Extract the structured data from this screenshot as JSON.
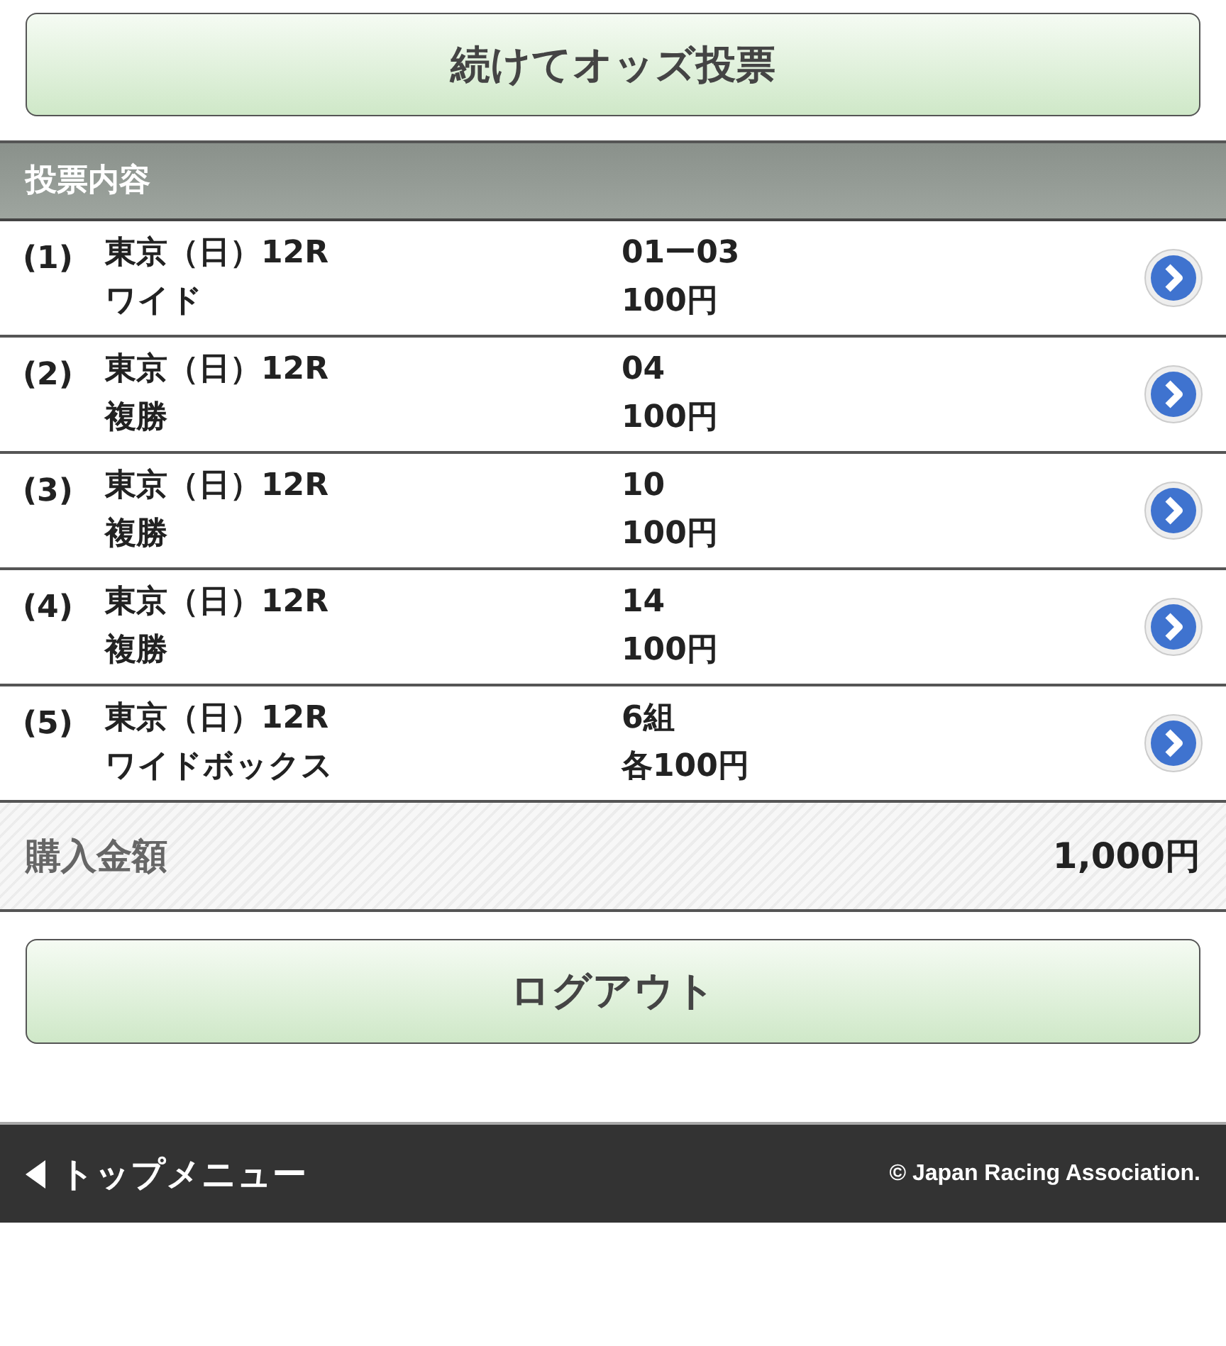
{
  "top_button": {
    "label": "続けてオッズ投票"
  },
  "section_header": {
    "title": "投票内容"
  },
  "bets": [
    {
      "index": "(1)",
      "race": "東京（日）12R",
      "bet_type": "ワイド",
      "selection": "01ー03",
      "amount": "100円"
    },
    {
      "index": "(2)",
      "race": "東京（日）12R",
      "bet_type": "複勝",
      "selection": "04",
      "amount": "100円"
    },
    {
      "index": "(3)",
      "race": "東京（日）12R",
      "bet_type": "複勝",
      "selection": "10",
      "amount": "100円"
    },
    {
      "index": "(4)",
      "race": "東京（日）12R",
      "bet_type": "複勝",
      "selection": "14",
      "amount": "100円"
    },
    {
      "index": "(5)",
      "race": "東京（日）12R",
      "bet_type": "ワイドボックス",
      "selection": "6組",
      "amount": "各100円"
    }
  ],
  "total": {
    "label": "購入金額",
    "value": "1,000円"
  },
  "logout_button": {
    "label": "ログアウト"
  },
  "footer": {
    "menu_link": "トップメニュー",
    "copyright": "© Japan Racing Association."
  }
}
